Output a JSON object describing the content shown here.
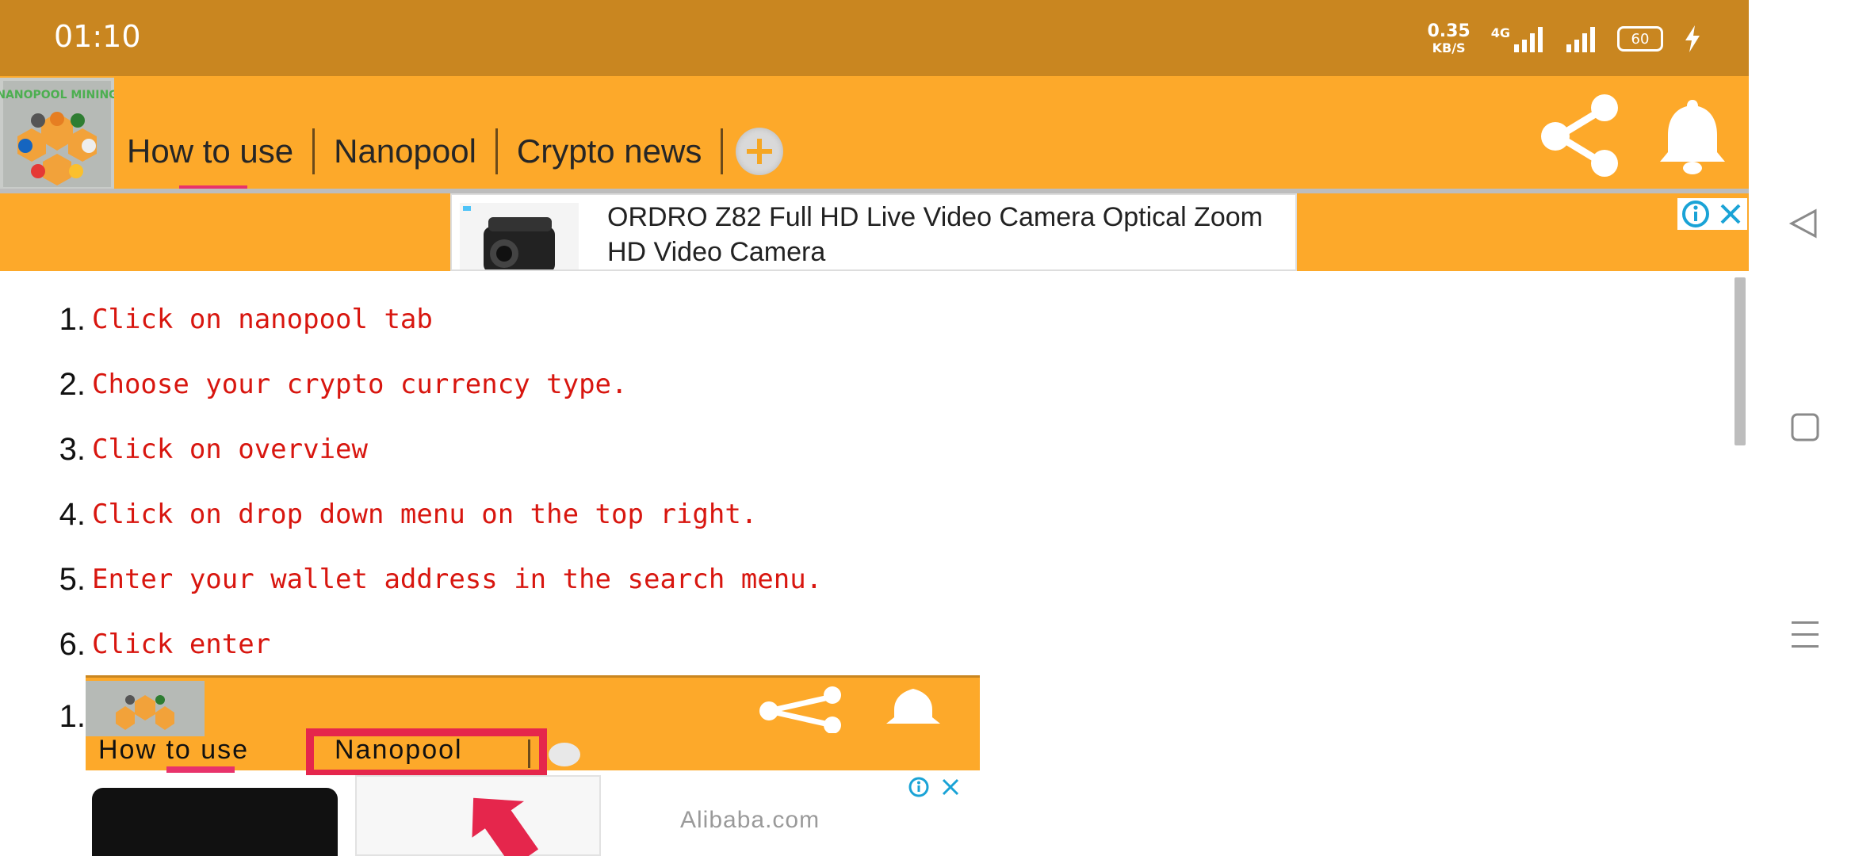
{
  "status_bar": {
    "time": "01:10",
    "net_speed_value": "0.35",
    "net_speed_unit": "KB/S",
    "network_type": "4G",
    "battery": "60"
  },
  "app_bar": {
    "logo_text": "NANOPOOL MINING",
    "tabs": [
      {
        "label": "How to use",
        "selected": true
      },
      {
        "label": "Nanopool",
        "selected": false
      },
      {
        "label": "Crypto news",
        "selected": false
      }
    ],
    "add_tab_icon": "plus-icon",
    "share_icon": "share-icon",
    "notification_icon": "bell-icon"
  },
  "ad": {
    "title": "ORDRO Z82 Full HD Live Video Camera Optical Zoom HD Video Camera",
    "info_icon": "info-icon",
    "close_icon": "close-icon"
  },
  "steps": [
    {
      "num": "1.",
      "text": "Click on nanopool tab"
    },
    {
      "num": "2.",
      "text": "Choose your crypto currency type."
    },
    {
      "num": "3.",
      "text": "Click on overview"
    },
    {
      "num": "4.",
      "text": "Click on drop down menu on the top right."
    },
    {
      "num": "5.",
      "text": "Enter your wallet address in the search menu."
    },
    {
      "num": "6.",
      "text": "Click enter"
    }
  ],
  "image_step": {
    "num": "1.",
    "tab_how_to_use": "How to use",
    "tab_nanopool": "Nanopool",
    "ad_brand": "Alibaba.com"
  },
  "colors": {
    "status_bar": "#C98620",
    "app_bar": "#FDA92A",
    "accent": "#E8326B",
    "step_text": "#D8160F"
  }
}
